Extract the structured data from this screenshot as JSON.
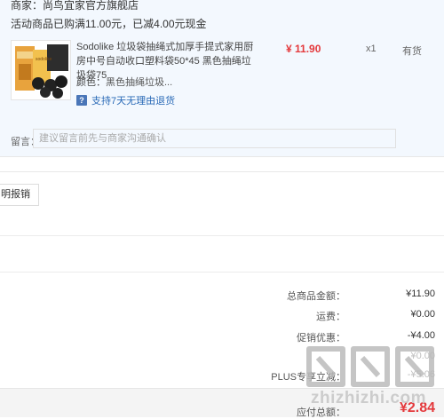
{
  "order": {
    "merchant_label": "商家：",
    "merchant_name": "尚鸟宜家官方旗舰店",
    "promo_text": "活动商品已购满11.00元，已减4.00元现金",
    "product": {
      "title": "Sodolike 垃圾袋抽绳式加厚手提式家用厨房中号自动收口塑料袋50*45 黑色抽绳垃圾袋75",
      "price": "¥ 11.90",
      "quantity": "x1",
      "stock": "有货",
      "color_label": "颜色：",
      "color_value": "黑色抽绳垃圾...",
      "return_policy": "支持7天无理由退货",
      "thumb_text": "sodolike"
    },
    "remark_label": "留言：",
    "remark_placeholder": "建议留言前先与商家沟通确认"
  },
  "invoice_button": "明报销",
  "summary": {
    "goods_total_label": "总商品金额：",
    "goods_total": "¥11.90",
    "shipping_label": "运费：",
    "shipping": "¥0.00",
    "promo_label": "促销优惠：",
    "promo": "-¥4.00",
    "row4_value": "¥0.00",
    "plus_label": "PLUS专享立减：",
    "plus_value": "-¥5.06",
    "total_label": "应付总额：",
    "total": "¥2.84"
  },
  "watermark": {
    "text": "zhizhizhi.com"
  },
  "colors": {
    "price_red": "#e4393c",
    "link_blue": "#2a6ab7",
    "panel_bg": "#f3f8fe"
  }
}
